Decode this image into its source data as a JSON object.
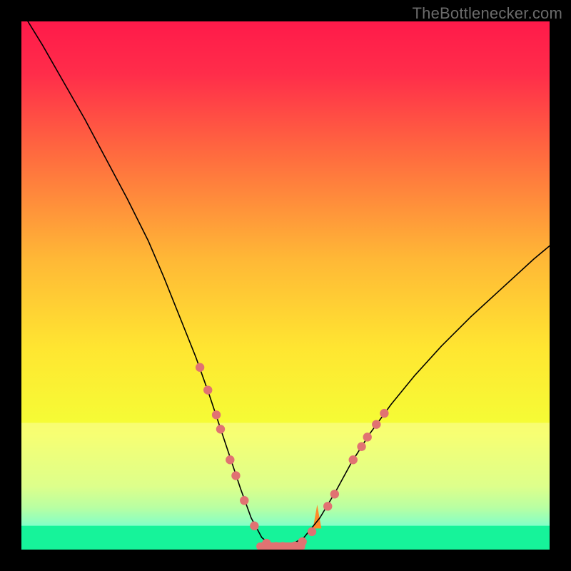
{
  "watermark": "TheBottlenecker.com",
  "chart_data": {
    "type": "line",
    "title": "",
    "xlabel": "",
    "ylabel": "",
    "xlim": [
      0,
      100
    ],
    "ylim": [
      0,
      100
    ],
    "grid": false,
    "background_gradient": {
      "stops": [
        {
          "pos": 0.0,
          "color": "#ff1a4a"
        },
        {
          "pos": 0.1,
          "color": "#ff2d4a"
        },
        {
          "pos": 0.25,
          "color": "#ff6a3f"
        },
        {
          "pos": 0.45,
          "color": "#ffb836"
        },
        {
          "pos": 0.62,
          "color": "#ffe631"
        },
        {
          "pos": 0.78,
          "color": "#f4ff36"
        },
        {
          "pos": 0.88,
          "color": "#cfff59"
        },
        {
          "pos": 0.92,
          "color": "#9bff7a"
        },
        {
          "pos": 0.955,
          "color": "#4dffb0"
        },
        {
          "pos": 0.985,
          "color": "#18ffa4"
        },
        {
          "pos": 1.0,
          "color": "#09f59a"
        }
      ],
      "green_band": {
        "y0": 0.0,
        "y1": 4.5
      },
      "light_band": {
        "y0": 4.5,
        "y1": 24.0
      }
    },
    "series": [
      {
        "name": "bottleneck-curve",
        "color": "#000000",
        "stroke_width": 1.6,
        "x": [
          0,
          4,
          8,
          12,
          16,
          20,
          24,
          27,
          30,
          33,
          35.5,
          37.5,
          39.5,
          41.5,
          43.5,
          45.5,
          47.5,
          50.5,
          53.5,
          56.5,
          59.5,
          62.5,
          66.0,
          70.0,
          74.5,
          79.5,
          85.0,
          91.0,
          97.0,
          100.0
        ],
        "y": [
          102,
          95.5,
          88.5,
          81.5,
          74.0,
          66.5,
          58.5,
          51.5,
          44.0,
          36.5,
          29.5,
          23.5,
          17.5,
          11.5,
          6.0,
          2.3,
          0.6,
          0.6,
          2.3,
          6.0,
          11.0,
          16.5,
          22.0,
          27.5,
          33.0,
          38.5,
          44.0,
          49.5,
          55.0,
          57.5
        ]
      }
    ],
    "markers": {
      "name": "highlighted-points",
      "color": "#e17272",
      "radius": 6.2,
      "points": [
        {
          "x": 33.8,
          "y": 34.5
        },
        {
          "x": 35.3,
          "y": 30.2
        },
        {
          "x": 36.9,
          "y": 25.5
        },
        {
          "x": 37.7,
          "y": 22.8
        },
        {
          "x": 39.5,
          "y": 17.0
        },
        {
          "x": 40.6,
          "y": 14.0
        },
        {
          "x": 42.2,
          "y": 9.3
        },
        {
          "x": 44.1,
          "y": 4.5
        },
        {
          "x": 46.4,
          "y": 1.2
        },
        {
          "x": 48.2,
          "y": 0.6
        },
        {
          "x": 49.5,
          "y": 0.6
        },
        {
          "x": 51.8,
          "y": 0.7
        },
        {
          "x": 53.2,
          "y": 1.5
        },
        {
          "x": 55.0,
          "y": 3.4
        },
        {
          "x": 58.0,
          "y": 8.2
        },
        {
          "x": 59.3,
          "y": 10.5
        },
        {
          "x": 62.8,
          "y": 17.0
        },
        {
          "x": 64.4,
          "y": 19.5
        },
        {
          "x": 65.5,
          "y": 21.3
        },
        {
          "x": 67.2,
          "y": 23.7
        },
        {
          "x": 68.7,
          "y": 25.8
        }
      ]
    },
    "flat_segment": {
      "name": "valley-flat",
      "color": "#e17272",
      "stroke_width": 11,
      "x0": 45.2,
      "x1": 53.0,
      "y": 0.6
    }
  }
}
